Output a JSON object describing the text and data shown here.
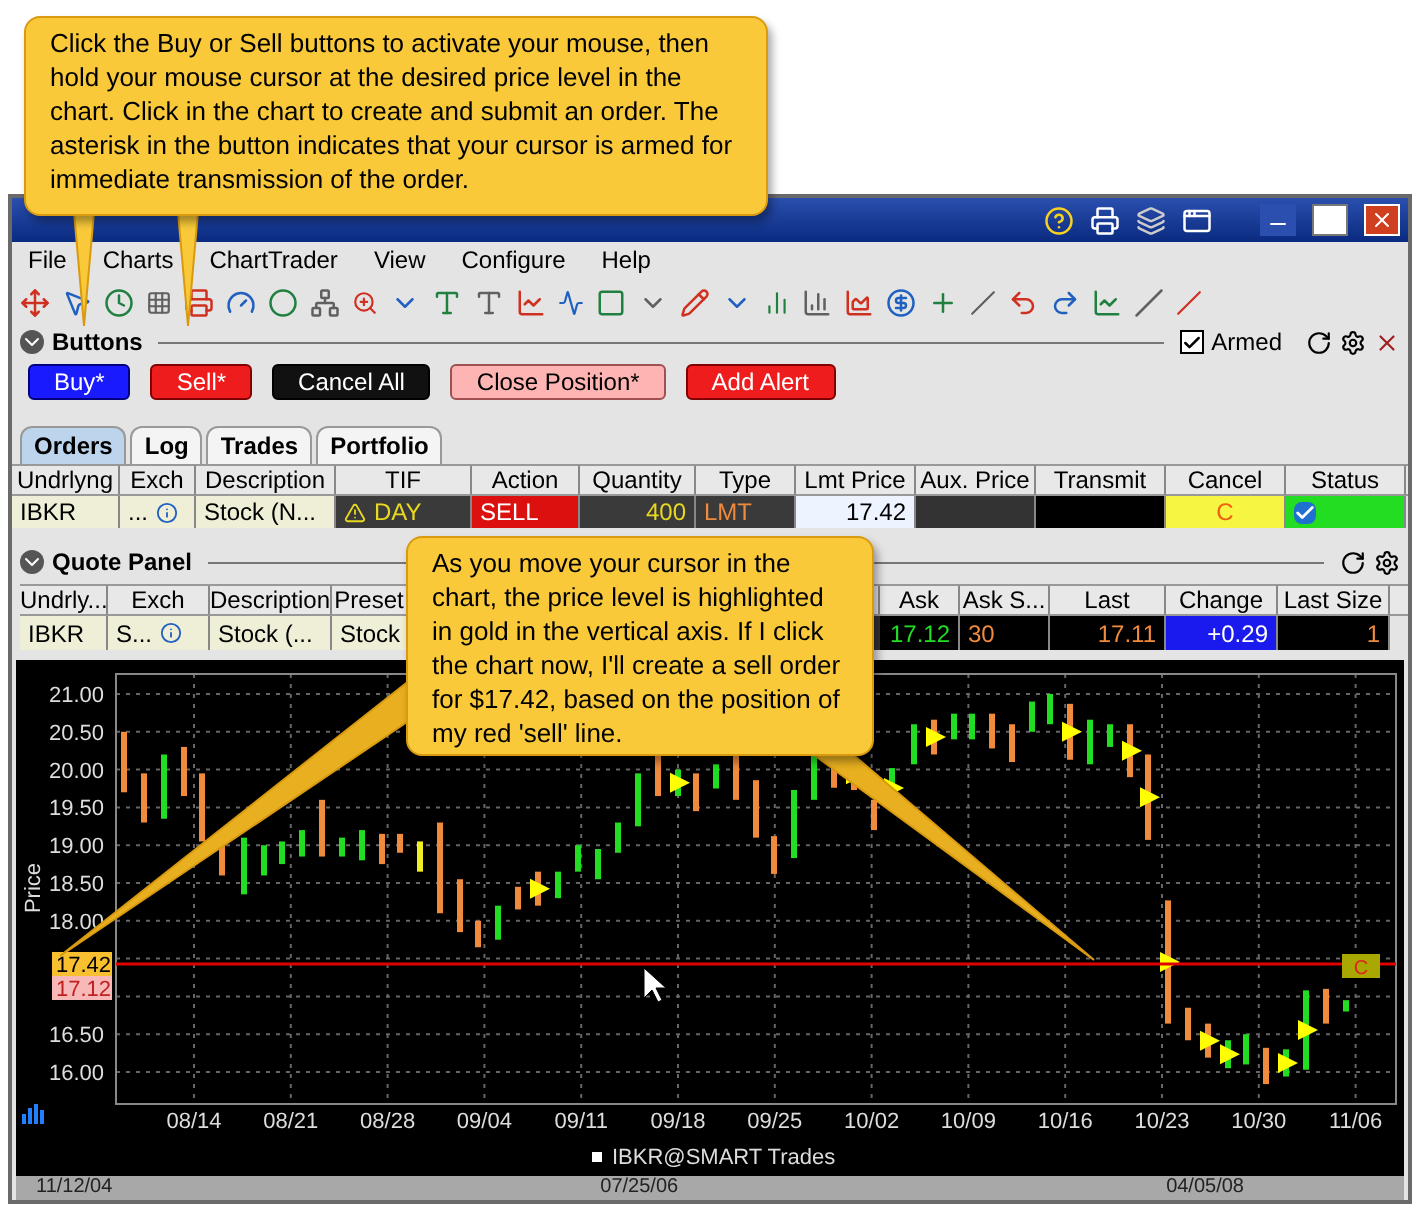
{
  "callouts": [
    {
      "text": "Click the Buy or Sell buttons to activate your mouse, then hold your mouse cursor at the desired price level in the chart. Click in the chart to create and submit an order. The asterisk in the button indicates that your cursor is armed for immediate transmission of the order."
    },
    {
      "text": "As you move your cursor in the chart, the price level is highlighted in gold in the vertical axis. If I click the chart now, I'll create a sell order for $17.42, based on the position of my red 'sell' line."
    }
  ],
  "menu": [
    "File",
    "Charts",
    "ChartTrader",
    "View",
    "Configure",
    "Help"
  ],
  "buttons_panel": {
    "title": "Buttons",
    "armed": {
      "label": "Armed",
      "checked": true
    },
    "buttons": [
      {
        "label": "Buy*",
        "kind": "buy"
      },
      {
        "label": "Sell*",
        "kind": "sell"
      },
      {
        "label": "Cancel All",
        "kind": "cancel"
      },
      {
        "label": "Close Position*",
        "kind": "close"
      },
      {
        "label": "Add Alert",
        "kind": "alert"
      }
    ]
  },
  "tabs": [
    {
      "label": "Orders",
      "selected": true
    },
    {
      "label": "Log",
      "selected": false
    },
    {
      "label": "Trades",
      "selected": false
    },
    {
      "label": "Portfolio",
      "selected": false
    }
  ],
  "orders": {
    "columns": [
      "Undrlyng",
      "Exch",
      "Description",
      "TIF",
      "Action",
      "Quantity",
      "Type",
      "Lmt Price",
      "Aux. Price",
      "Transmit",
      "Cancel",
      "Status"
    ],
    "rows": [
      {
        "cells": [
          "IBKR",
          "...",
          "Stock (N...",
          "DAY",
          "SELL",
          "400",
          "LMT",
          "17.42",
          "",
          "",
          "C"
        ]
      }
    ]
  },
  "quote_panel": {
    "title": "Quote Panel",
    "columns": [
      "Undrly...",
      "Exch",
      "Description",
      "Preset",
      "Ask",
      "Ask S...",
      "Last",
      "Change",
      "Last Size"
    ],
    "rows": [
      {
        "cells": [
          "IBKR",
          "S...",
          "Stock (...",
          "Stock",
          "17.12",
          "30",
          "17.11",
          "+0.29",
          "1"
        ]
      }
    ]
  },
  "chart": {
    "ylabel": "Price",
    "yticks": [
      "21.00",
      "20.50",
      "20.00",
      "19.50",
      "19.00",
      "18.50",
      "18.00",
      "16.50",
      "16.00"
    ],
    "xticks": [
      "08/14",
      "08/21",
      "08/28",
      "09/04",
      "09/11",
      "09/18",
      "09/25",
      "10/02",
      "10/09",
      "10/16",
      "10/23",
      "10/30",
      "11/06"
    ],
    "price_tags": [
      {
        "label": "17.42",
        "kind": "cursor"
      },
      {
        "label": "17.12",
        "kind": "last"
      }
    ],
    "order_marker": "C",
    "legend": "IBKR@SMART Trades"
  },
  "scrollbar": {
    "dates": [
      "11/12/04",
      "07/25/06",
      "04/05/08"
    ]
  }
}
